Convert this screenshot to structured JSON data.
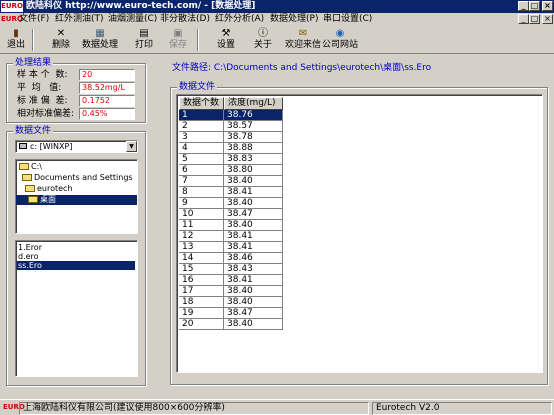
{
  "window": {
    "logo": "EURO",
    "title": "欧陆科仪  http://www.euro-tech.com/ - [数据处理]",
    "minimize": "_",
    "maximize": "□",
    "close": "×"
  },
  "menu": {
    "logo": "EURO",
    "items": [
      "文件(F)",
      "红外测油(T)",
      "油烟测量(C)",
      "非分散法(D)",
      "红外分析(A)",
      "数据处理(P)",
      "串口设置(C)"
    ],
    "right_min": "_",
    "right_max": "□",
    "right_close": "×"
  },
  "toolbar": {
    "exit": "退出",
    "delete": "删除",
    "process": "数据处理",
    "print": "打印",
    "save": "保存",
    "settings": "设置",
    "about": "关于",
    "welcome": "欢迎来信",
    "website": "公司网站"
  },
  "results": {
    "title": "处理结果",
    "rows": [
      {
        "label": "样 本 个  数:",
        "value": "20"
      },
      {
        "label": "平  均   值:",
        "value": "38.52mg/L"
      },
      {
        "label": "标 准 偏  差:",
        "value": "0.1752"
      },
      {
        "label": "相对标准偏差:",
        "value": "0.45%"
      }
    ]
  },
  "files": {
    "title": "数据文件",
    "drive": "c: [WINXP]",
    "tree": [
      "C:\\",
      "Documents and Settings",
      "eurotech",
      "桌面"
    ],
    "list": [
      "1.Eror",
      "d.ero",
      "ss.Ero"
    ],
    "selected_file": "ss.Ero"
  },
  "main": {
    "path_label": "文件路径: C:\\Documents and Settings\\eurotech\\桌面\\ss.Ero",
    "table_title": "数据文件",
    "columns": [
      "数据个数",
      "浓度(mg/L)"
    ],
    "rows": [
      [
        "1",
        "38.76"
      ],
      [
        "2",
        "38.57"
      ],
      [
        "3",
        "38.78"
      ],
      [
        "4",
        "38.88"
      ],
      [
        "5",
        "38.83"
      ],
      [
        "6",
        "38.80"
      ],
      [
        "7",
        "38.40"
      ],
      [
        "8",
        "38.41"
      ],
      [
        "9",
        "38.40"
      ],
      [
        "10",
        "38.47"
      ],
      [
        "11",
        "38.40"
      ],
      [
        "12",
        "38.41"
      ],
      [
        "13",
        "38.41"
      ],
      [
        "14",
        "38.46"
      ],
      [
        "15",
        "38.43"
      ],
      [
        "16",
        "38.41"
      ],
      [
        "17",
        "38.40"
      ],
      [
        "18",
        "38.40"
      ],
      [
        "19",
        "38.47"
      ],
      [
        "20",
        "38.40"
      ]
    ]
  },
  "status": {
    "logo": "EURO",
    "company": "上海欧陆科仪有限公司(建议使用800×600分辨率)",
    "version": "Eurotech   V2.0"
  },
  "colors": {
    "accent": "#0a246a",
    "value_red": "#e00000",
    "group_title": "#0000c0"
  }
}
